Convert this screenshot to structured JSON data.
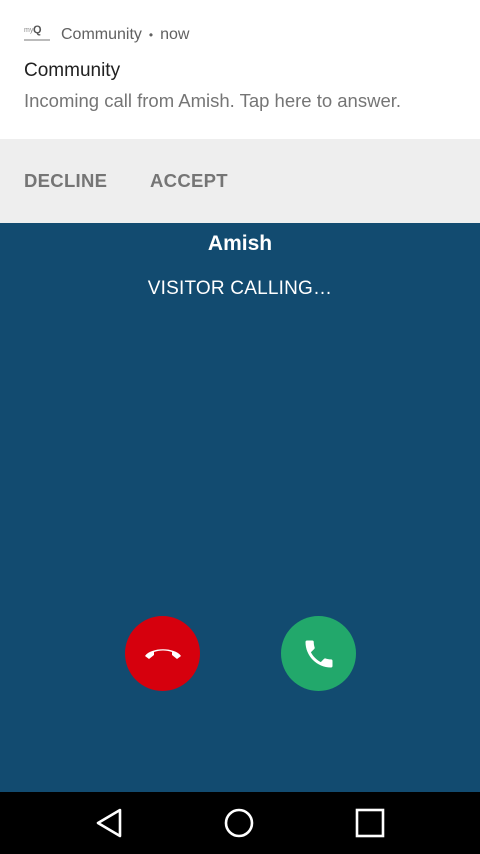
{
  "notification": {
    "app_name": "Community",
    "separator": "•",
    "time": "now",
    "title": "Community",
    "body": "Incoming call from Amish. Tap here to answer.",
    "icon": "myq-community-logo-icon",
    "actions": {
      "decline": "DECLINE",
      "accept": "ACCEPT"
    }
  },
  "call": {
    "caller": "Amish",
    "status": "VISITOR CALLING…",
    "decline_icon": "hang-up-icon",
    "accept_icon": "phone-icon"
  },
  "navbar": {
    "back_icon": "back-icon",
    "home_icon": "home-icon",
    "recents_icon": "recents-icon"
  },
  "colors": {
    "call_background": "#124b70",
    "decline": "#d6000d",
    "accept": "#22a86b"
  }
}
